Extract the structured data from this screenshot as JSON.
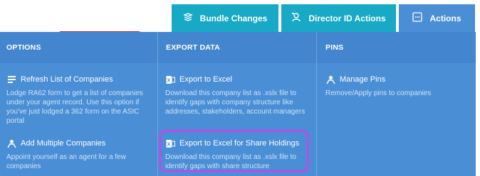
{
  "tabs": {
    "bundle": "Bundle Changes",
    "director": "Director ID Actions",
    "actions": "Actions"
  },
  "columns": {
    "options": "OPTIONS",
    "export": "EXPORT DATA",
    "pins": "PINS"
  },
  "options_items": [
    {
      "label": "Refresh List of Companies",
      "desc": "Lodge RA62 form to get a list of companies under your agent record. Use this option if you've just lodged a 362 form on the ASIC portal"
    },
    {
      "label": "Add Multiple Companies",
      "desc": "Appoint yourself as an agent for a few companies"
    }
  ],
  "export_items": [
    {
      "label": "Export to Excel",
      "desc": "Download this company list as .xslx file to identify gaps with company structure like addresses, stakeholders, account managers"
    },
    {
      "label": "Export to Excel for Share Holdings",
      "desc": "Download this company list as .xslx file to identify gaps with share structure"
    }
  ],
  "pins_items": [
    {
      "label": "Manage Pins",
      "desc": "Remove/Apply pins to companies"
    }
  ],
  "colors": {
    "tab_teal": "#17a9c6",
    "panel_blue": "#4a8fd6",
    "highlight": "#d63de8",
    "accent_red": "#c9302c"
  }
}
